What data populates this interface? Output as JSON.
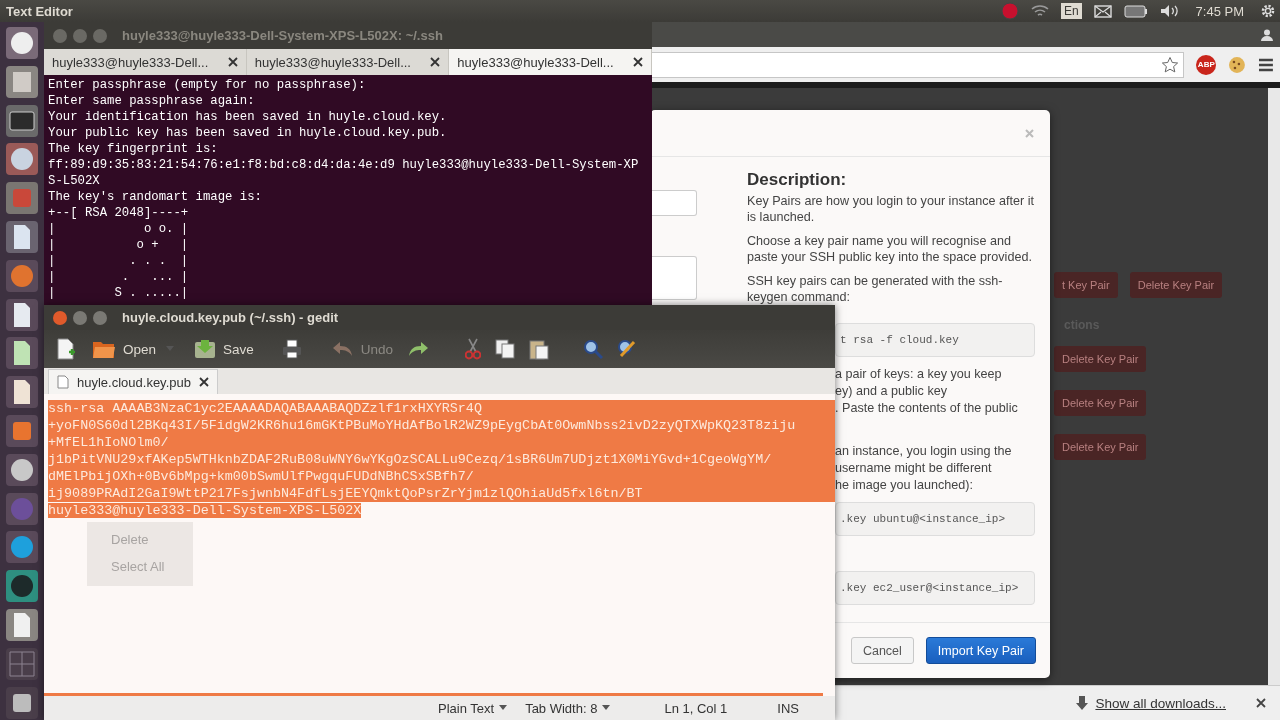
{
  "top_bar": {
    "title": "Text Editor",
    "language": "En",
    "time": "7:45 PM"
  },
  "terminal": {
    "title": "huyle333@huyle333-Dell-System-XPS-L502X: ~/.ssh",
    "tabs": [
      {
        "label": "huyle333@huyle333-Dell...",
        "selected": false
      },
      {
        "label": "huyle333@huyle333-Dell...",
        "selected": false
      },
      {
        "label": "huyle333@huyle333-Dell...",
        "selected": true
      }
    ],
    "lines": [
      "Enter passphrase (empty for no passphrase):",
      "Enter same passphrase again:",
      "Your identification has been saved in huyle.cloud.key.",
      "Your public key has been saved in huyle.cloud.key.pub.",
      "The key fingerprint is:",
      "ff:89:d9:35:83:21:54:76:e1:f8:bd:c8:d4:da:4e:d9 huyle333@huyle333-Dell-System-XP",
      "S-L502X",
      "The key's randomart image is:",
      "+--[ RSA 2048]----+",
      "|            o o. |",
      "|           o +   |",
      "|          . . .  |",
      "|         .   ... |",
      "|        S . .....|"
    ]
  },
  "browser": {
    "extension_badge": "ABP",
    "background_page": {
      "top_buttons": [
        "t Key Pair",
        "Delete Key Pair"
      ],
      "heading": "ctions",
      "row_buttons": [
        "Delete Key Pair",
        "Delete Key Pair",
        "Delete Key Pair"
      ]
    },
    "dialog": {
      "heading": "Description:",
      "paragraphs": [
        "Key Pairs are how you login to your instance after it is launched.",
        "Choose a key pair name you will recognise and paste your SSH public key into the space provided.",
        "SSH key pairs can be generated with the ssh-keygen command:"
      ],
      "code_1": "t rsa -f cloud.key",
      "fragments_1": [
        "a pair of keys: a key you keep",
        "ey) and a public key",
        ". Paste the contents of the public"
      ],
      "fragments_2": [
        "an instance, you login using the",
        "username might be different",
        "he image you launched):"
      ],
      "code_2": ".key ubuntu@<instance_ip>",
      "code_3": ".key ec2_user@<instance_ip>",
      "buttons": [
        {
          "label": "Cancel",
          "kind": "secondary"
        },
        {
          "label": "Import Key Pair",
          "kind": "primary"
        }
      ]
    },
    "downloads_link": "Show all downloads..."
  },
  "gedit": {
    "title": "huyle.cloud.key.pub (~/.ssh) - gedit",
    "toolbar": [
      {
        "kind": "new",
        "disabled": false
      },
      {
        "kind": "open",
        "label": "Open",
        "disabled": false
      },
      {
        "kind": "dropdown",
        "disabled": false
      },
      {
        "kind": "save",
        "label": "Save",
        "disabled": false
      },
      {
        "kind": "print",
        "disabled": false
      },
      {
        "kind": "undo",
        "label": "Undo",
        "disabled": true
      },
      {
        "kind": "redo",
        "disabled": false
      },
      {
        "kind": "cut",
        "disabled": false
      },
      {
        "kind": "copy",
        "disabled": false
      },
      {
        "kind": "paste",
        "disabled": false
      },
      {
        "kind": "find",
        "disabled": false
      },
      {
        "kind": "replace",
        "disabled": false
      }
    ],
    "tab": "huyle.cloud.key.pub",
    "text": {
      "selected": true,
      "lines": [
        "ssh-rsa AAAAB3NzaC1yc2EAAAADAQABAAABAQDZzlf1rxHXYRSr4Q",
        "+yoFN0S60dl2BKq43I/5FidgW2KR6hu16mGKtPBuMoYHdAfBolR2WZ9pEygCbAt0OwmNbss2ivD2zyQTXWpKQ23T8ziju",
        "+MfEL1hIoNOlm0/",
        "j1bPitVNU29xfAKep5WTHknbZDAF2RuB08uWNY6wYKgOzSCALLu9Cezq/1sBR6Um7UDjzt1X0MiYGvd+1CgeoWgYM/",
        "dMElPbijOXh+0Bv6bMpg+km00bSwmUlfPwgquFUDdNBhCSxSBfh7/",
        "ij9089PRAdI2GaI9WttP217FsjwnbN4FdfLsjEEYQmktQoPsrZrYjm1zlQOhiaUd5fxl6tn/BT",
        "huyle333@huyle333-Dell-System-XPS-L502X"
      ]
    },
    "context_menu": [
      "Delete",
      "Select All"
    ],
    "status": {
      "language": "Plain Text",
      "tab_width": "Tab Width: 8",
      "position": "Ln 1, Col 1",
      "mode": "INS"
    }
  }
}
